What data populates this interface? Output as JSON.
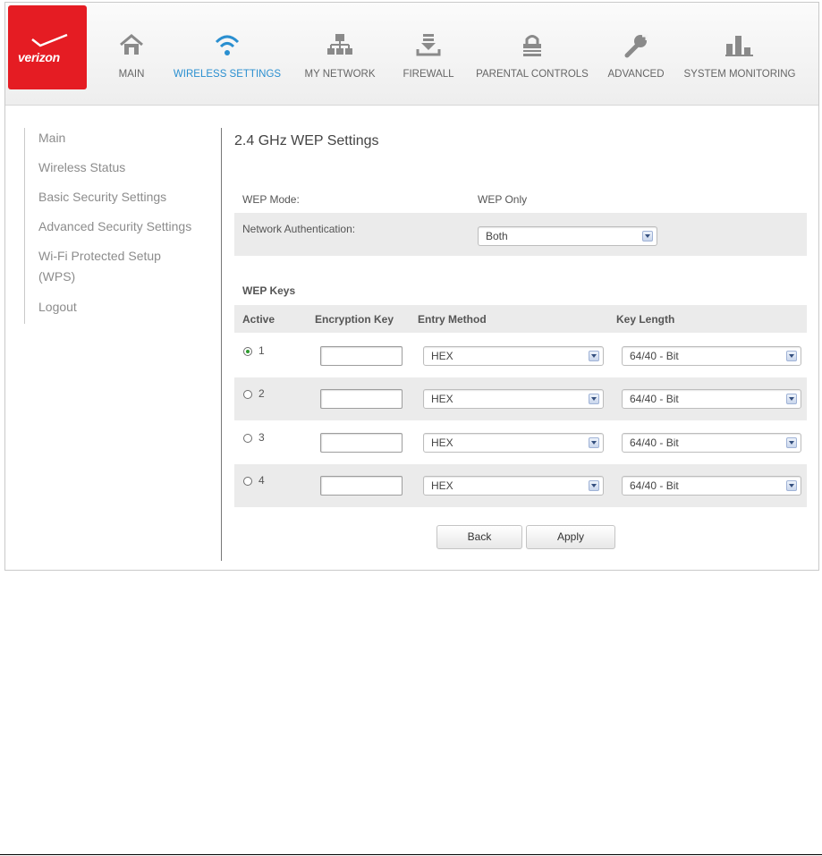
{
  "brand": {
    "logo_text": "verizon",
    "accent": "#e51c23",
    "active_nav_color": "#2a8fd0"
  },
  "nav": [
    {
      "label": "MAIN",
      "icon": "home-icon",
      "active": false
    },
    {
      "label": "WIRELESS SETTINGS",
      "icon": "wifi-icon",
      "active": true
    },
    {
      "label": "MY NETWORK",
      "icon": "network-icon",
      "active": false
    },
    {
      "label": "FIREWALL",
      "icon": "firewall-icon",
      "active": false
    },
    {
      "label": "PARENTAL CONTROLS",
      "icon": "lock-icon",
      "active": false
    },
    {
      "label": "ADVANCED",
      "icon": "wrench-icon",
      "active": false
    },
    {
      "label": "SYSTEM MONITORING",
      "icon": "bar-chart-icon",
      "active": false
    }
  ],
  "sidebar": {
    "items": [
      "Main",
      "Wireless Status",
      "Basic Security Settings",
      "Advanced Security Settings",
      "Wi-Fi Protected Setup",
      "(WPS)",
      "Logout"
    ]
  },
  "page": {
    "title": "2.4 GHz WEP Settings",
    "wep_mode_label": "WEP Mode:",
    "wep_mode_value": "WEP Only",
    "net_auth_label": "Network Authentication:",
    "net_auth_value": "Both",
    "wep_keys_heading": "WEP Keys"
  },
  "table": {
    "headers": [
      "Active",
      "Encryption Key",
      "Entry Method",
      "Key Length"
    ],
    "rows": [
      {
        "num": "1",
        "checked": true,
        "key": "",
        "method": "HEX",
        "length": "64/40 - Bit"
      },
      {
        "num": "2",
        "checked": false,
        "key": "",
        "method": "HEX",
        "length": "64/40 - Bit"
      },
      {
        "num": "3",
        "checked": false,
        "key": "",
        "method": "HEX",
        "length": "64/40 - Bit"
      },
      {
        "num": "4",
        "checked": false,
        "key": "",
        "method": "HEX",
        "length": "64/40 - Bit"
      }
    ]
  },
  "buttons": {
    "back": "Back",
    "apply": "Apply"
  }
}
